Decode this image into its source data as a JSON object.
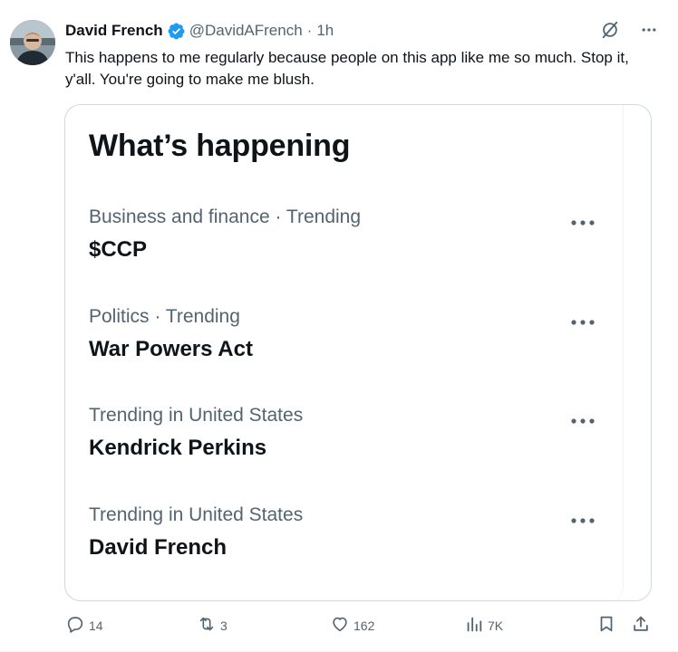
{
  "author": {
    "name": "David French",
    "handle": "@DavidAFrench",
    "separator": "·",
    "time": "1h"
  },
  "tweet": {
    "text": "This happens to me regularly because people on this app like me so much. Stop it, y'all. You're going to make me blush."
  },
  "card": {
    "title": "What’s happening",
    "trends": [
      {
        "context": "Business and finance · Trending",
        "name": "$CCP"
      },
      {
        "context": "Politics · Trending",
        "name": "War Powers Act"
      },
      {
        "context": "Trending in United States",
        "name": "Kendrick Perkins"
      },
      {
        "context": "Trending in United States",
        "name": "David French"
      }
    ]
  },
  "actions": {
    "replies": "14",
    "reposts": "3",
    "likes": "162",
    "views": "7K"
  },
  "icons": {
    "verified": "verified-badge-icon",
    "grok": "grok-icon",
    "more": "more-icon",
    "reply": "reply-icon",
    "repost": "repost-icon",
    "like": "heart-icon",
    "views": "views-icon",
    "bookmark": "bookmark-icon",
    "share": "share-icon"
  },
  "colors": {
    "text": "#0f1419",
    "secondary": "#536471",
    "verified": "#1d9bf0",
    "border": "#cfd9de"
  }
}
